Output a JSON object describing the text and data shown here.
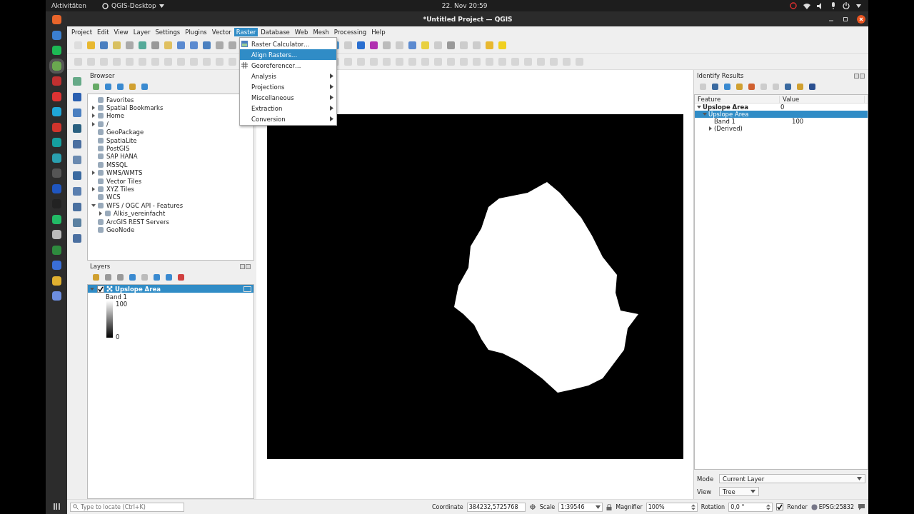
{
  "top_bar": {
    "activities": "Aktivitäten",
    "app": "QGIS-Desktop",
    "clock": "22. Nov  20:59"
  },
  "window": {
    "title": "*Untitled Project — QGIS"
  },
  "menu_bar": [
    {
      "label": "Project",
      "selected": false
    },
    {
      "label": "Edit",
      "selected": false
    },
    {
      "label": "View",
      "selected": false
    },
    {
      "label": "Layer",
      "selected": false
    },
    {
      "label": "Settings",
      "selected": false
    },
    {
      "label": "Plugins",
      "selected": false
    },
    {
      "label": "Vector",
      "selected": false
    },
    {
      "label": "Raster",
      "selected": true
    },
    {
      "label": "Database",
      "selected": false
    },
    {
      "label": "Web",
      "selected": false
    },
    {
      "label": "Mesh",
      "selected": false
    },
    {
      "label": "Processing",
      "selected": false
    },
    {
      "label": "Help",
      "selected": false
    }
  ],
  "raster_menu": [
    {
      "label": "Raster Calculator…",
      "kind": "action",
      "selected": false
    },
    {
      "label": "Align Rasters…",
      "kind": "action",
      "selected": true
    },
    {
      "label": "Georeferencer…",
      "kind": "action",
      "selected": false
    },
    {
      "label": "Analysis",
      "kind": "submenu",
      "selected": false
    },
    {
      "label": "Projections",
      "kind": "submenu",
      "selected": false
    },
    {
      "label": "Miscellaneous",
      "kind": "submenu",
      "selected": false
    },
    {
      "label": "Extraction",
      "kind": "submenu",
      "selected": false
    },
    {
      "label": "Conversion",
      "kind": "submenu",
      "selected": false
    }
  ],
  "browser": {
    "title": "Browser",
    "items": [
      {
        "label": "Favorites"
      },
      {
        "label": "Spatial Bookmarks",
        "expanded": false
      },
      {
        "label": "Home",
        "expanded": false
      },
      {
        "label": "/",
        "expanded": false
      },
      {
        "label": "GeoPackage"
      },
      {
        "label": "SpatiaLite"
      },
      {
        "label": "PostGIS"
      },
      {
        "label": "SAP HANA"
      },
      {
        "label": "MSSQL"
      },
      {
        "label": "WMS/WMTS",
        "expanded": false
      },
      {
        "label": "Vector Tiles"
      },
      {
        "label": "XYZ Tiles",
        "expanded": false
      },
      {
        "label": "WCS"
      },
      {
        "label": "WFS / OGC API - Features",
        "expanded": true,
        "children": [
          {
            "label": "Alkis_vereinfacht",
            "expanded": false
          }
        ]
      },
      {
        "label": "ArcGIS REST Servers"
      },
      {
        "label": "GeoNode"
      }
    ]
  },
  "layers": {
    "title": "Layers",
    "items": [
      {
        "name": "Upslope Area",
        "checked": true,
        "selected": true,
        "expanded": true,
        "band": "Band 1",
        "max": "100",
        "min": "0"
      }
    ]
  },
  "identify": {
    "title": "Identify Results",
    "columns": [
      "Feature",
      "Value"
    ],
    "rows": [
      {
        "feature": "Upslope Area",
        "value": "0",
        "expanded": true,
        "selected": false,
        "children": [
          {
            "feature": "Upslope Area",
            "expanded": true,
            "selected": true,
            "children": [
              {
                "feature": "Band 1",
                "value": "100",
                "selected": false
              },
              {
                "feature": "(Derived)",
                "expanded": false,
                "selected": false
              }
            ]
          }
        ]
      }
    ],
    "mode": {
      "label": "Mode",
      "value": "Current Layer"
    },
    "view": {
      "label": "View",
      "value": "Tree"
    }
  },
  "status_bar": {
    "locate_placeholder": "Type to locate (Ctrl+K)",
    "coordinate_label": "Coordinate",
    "coordinate": "384232,5725768",
    "scale_label": "Scale",
    "scale": "1:39546",
    "magnifier_label": "Magnifier",
    "magnifier": "100%",
    "rotation_label": "Rotation",
    "rotation": "0,0 °",
    "render_label": "Render",
    "render_checked": true,
    "crs": "EPSG:25832"
  }
}
